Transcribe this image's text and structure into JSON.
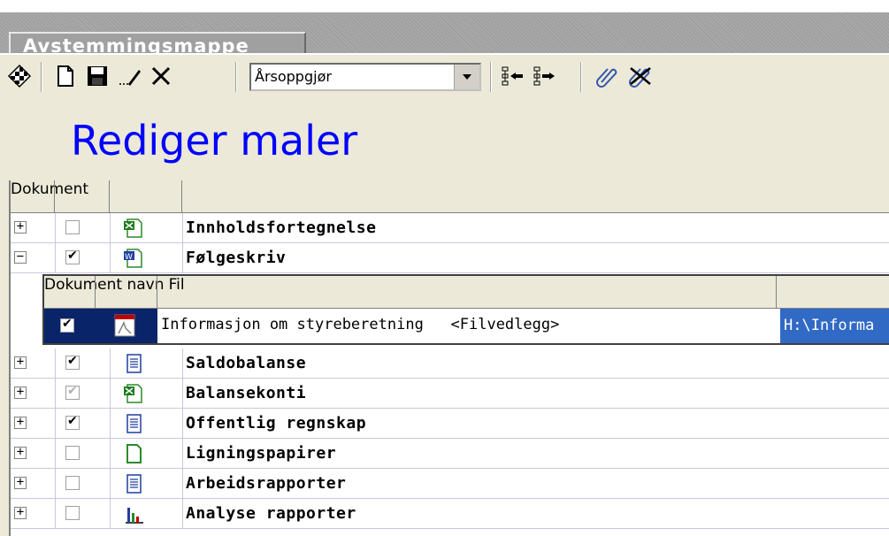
{
  "window": {
    "tab_title": "Avstemmingsmappe"
  },
  "toolbar": {
    "icons": [
      "checkered-flag-icon",
      "new-document-icon",
      "save-icon",
      "edit-icon",
      "delete-icon",
      "move-left-icon",
      "move-right-icon",
      "attach-icon",
      "detach-icon"
    ],
    "combo_value": "Årsoppgjør"
  },
  "page": {
    "heading": "Rediger maler"
  },
  "grid": {
    "column_header": "Dokument",
    "rows": [
      {
        "name": "Innholdsfortegnelse",
        "expander": "+",
        "checked": "off",
        "icon": "excel-doc-icon"
      },
      {
        "name": "Følgeskriv",
        "expander": "−",
        "checked": "on",
        "icon": "word-doc-icon"
      },
      {
        "name": "Saldobalanse",
        "expander": "+",
        "checked": "on",
        "icon": "report-doc-icon"
      },
      {
        "name": "Balansekonti",
        "expander": "+",
        "checked": "grey",
        "icon": "excel-doc-icon"
      },
      {
        "name": "Offentlig regnskap",
        "expander": "+",
        "checked": "on",
        "icon": "report-doc-icon"
      },
      {
        "name": "Ligningspapirer",
        "expander": "+",
        "checked": "off",
        "icon": "blank-doc-icon"
      },
      {
        "name": "Arbeidsrapporter",
        "expander": "+",
        "checked": "off",
        "icon": "report-doc-icon"
      },
      {
        "name": "Analyse rapporter",
        "expander": "+",
        "checked": "off",
        "icon": "bar-chart-icon"
      }
    ]
  },
  "subgrid": {
    "col_doc": "Dokument navn",
    "col_fil": "Fil",
    "row": {
      "doc": "Informasjon om styreberetning   <Filvedlegg>",
      "fil": "H:\\Informa",
      "checked": "on",
      "icon": "pdf-doc-icon"
    }
  }
}
